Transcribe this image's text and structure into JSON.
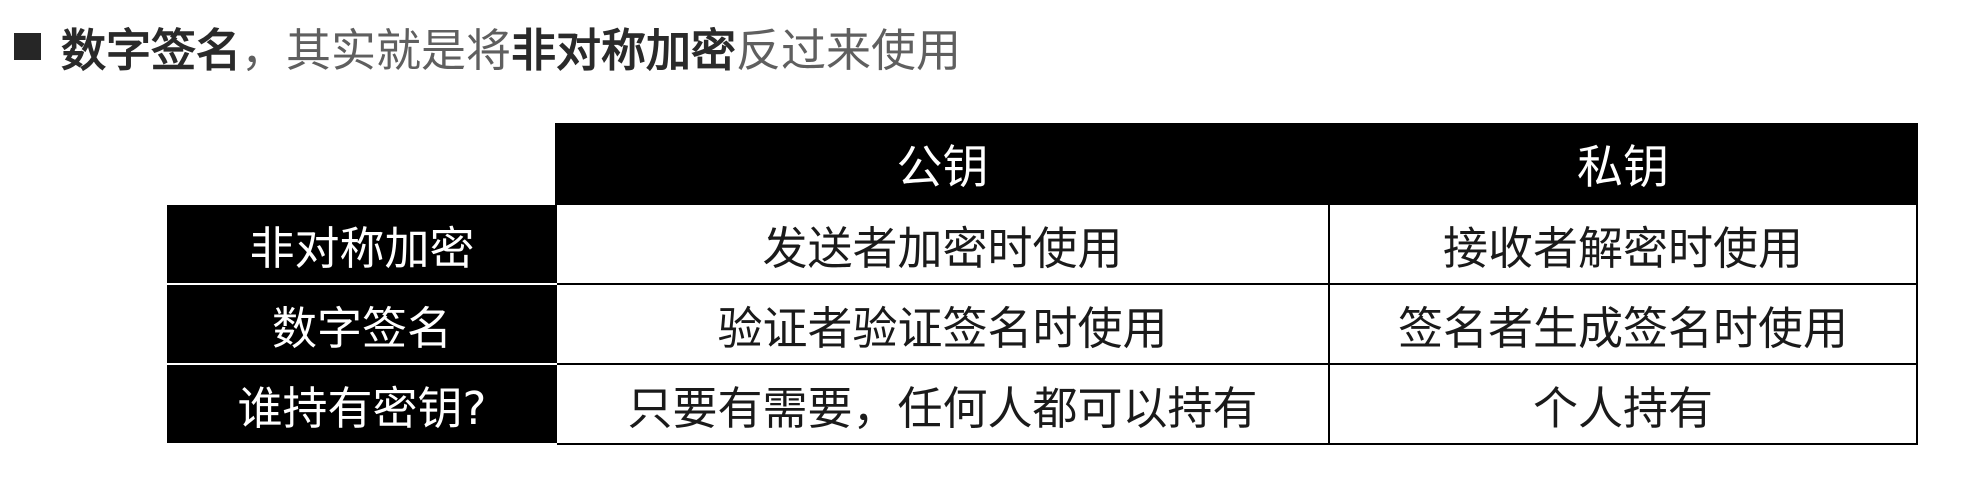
{
  "heading": {
    "bullet_icon": "square-bullet-icon",
    "part1_bold": "数字签名",
    "part2": "，其实就是将",
    "part3_bold": "非对称加密",
    "part4": "反过来使用"
  },
  "table": {
    "columns": [
      "",
      "公钥",
      "私钥"
    ],
    "rows": [
      {
        "label": "非对称加密",
        "public_key": "发送者加密时使用",
        "private_key": "接收者解密时使用"
      },
      {
        "label": "数字签名",
        "public_key": "验证者验证签名时使用",
        "private_key": "签名者生成签名时使用"
      },
      {
        "label": "谁持有密钥?",
        "public_key": "只要有需要，任何人都可以持有",
        "private_key": "个人持有"
      }
    ]
  },
  "colors": {
    "header_bg": "#000000",
    "header_text": "#ffffff",
    "cell_text": "#1a1a1a"
  }
}
